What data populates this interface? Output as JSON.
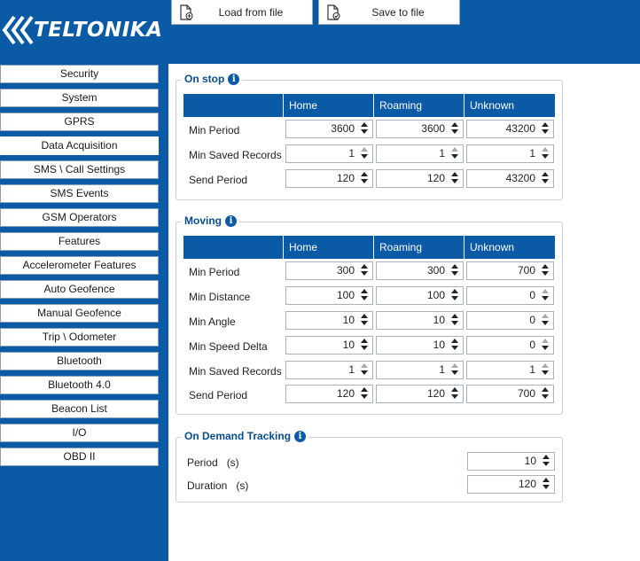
{
  "brand": {
    "logo_text": "TELTONIKA"
  },
  "toolbar": {
    "load_label": "Load from file",
    "save_label": "Save to file"
  },
  "sidebar": {
    "items": [
      {
        "label": "Security"
      },
      {
        "label": "System"
      },
      {
        "label": "GPRS"
      },
      {
        "label": "Data Acquisition",
        "active": true
      },
      {
        "label": "SMS \\ Call Settings"
      },
      {
        "label": "SMS Events"
      },
      {
        "label": "GSM Operators"
      },
      {
        "label": "Features"
      },
      {
        "label": "Accelerometer Features"
      },
      {
        "label": "Auto Geofence"
      },
      {
        "label": "Manual Geofence"
      },
      {
        "label": "Trip \\ Odometer"
      },
      {
        "label": "Bluetooth"
      },
      {
        "label": "Bluetooth 4.0"
      },
      {
        "label": "Beacon List"
      },
      {
        "label": "I/O"
      },
      {
        "label": "OBD II"
      }
    ]
  },
  "columns": {
    "home": "Home",
    "roaming": "Roaming",
    "unknown": "Unknown"
  },
  "on_stop": {
    "title": "On stop",
    "rows": [
      {
        "label": "Min Period",
        "home": "3600",
        "roaming": "3600",
        "unknown": "43200"
      },
      {
        "label": "Min Saved Records",
        "home": "1",
        "roaming": "1",
        "unknown": "1"
      },
      {
        "label": "Send Period",
        "home": "120",
        "roaming": "120",
        "unknown": "43200"
      }
    ]
  },
  "moving": {
    "title": "Moving",
    "rows": [
      {
        "label": "Min Period",
        "home": "300",
        "roaming": "300",
        "unknown": "700"
      },
      {
        "label": "Min Distance",
        "home": "100",
        "roaming": "100",
        "unknown": "0"
      },
      {
        "label": "Min Angle",
        "home": "10",
        "roaming": "10",
        "unknown": "0"
      },
      {
        "label": "Min Speed Delta",
        "home": "10",
        "roaming": "10",
        "unknown": "0"
      },
      {
        "label": "Min Saved Records",
        "home": "1",
        "roaming": "1",
        "unknown": "1"
      },
      {
        "label": "Send Period",
        "home": "120",
        "roaming": "120",
        "unknown": "700"
      }
    ]
  },
  "on_demand": {
    "title": "On Demand Tracking",
    "rows": [
      {
        "label": "Period   (s)",
        "value": "10"
      },
      {
        "label": "Duration   (s)",
        "value": "120"
      }
    ]
  },
  "colors": {
    "brand_blue": "#0a5aa5",
    "header_blue": "#0a5aa5",
    "title_blue": "#0a4c8c"
  }
}
